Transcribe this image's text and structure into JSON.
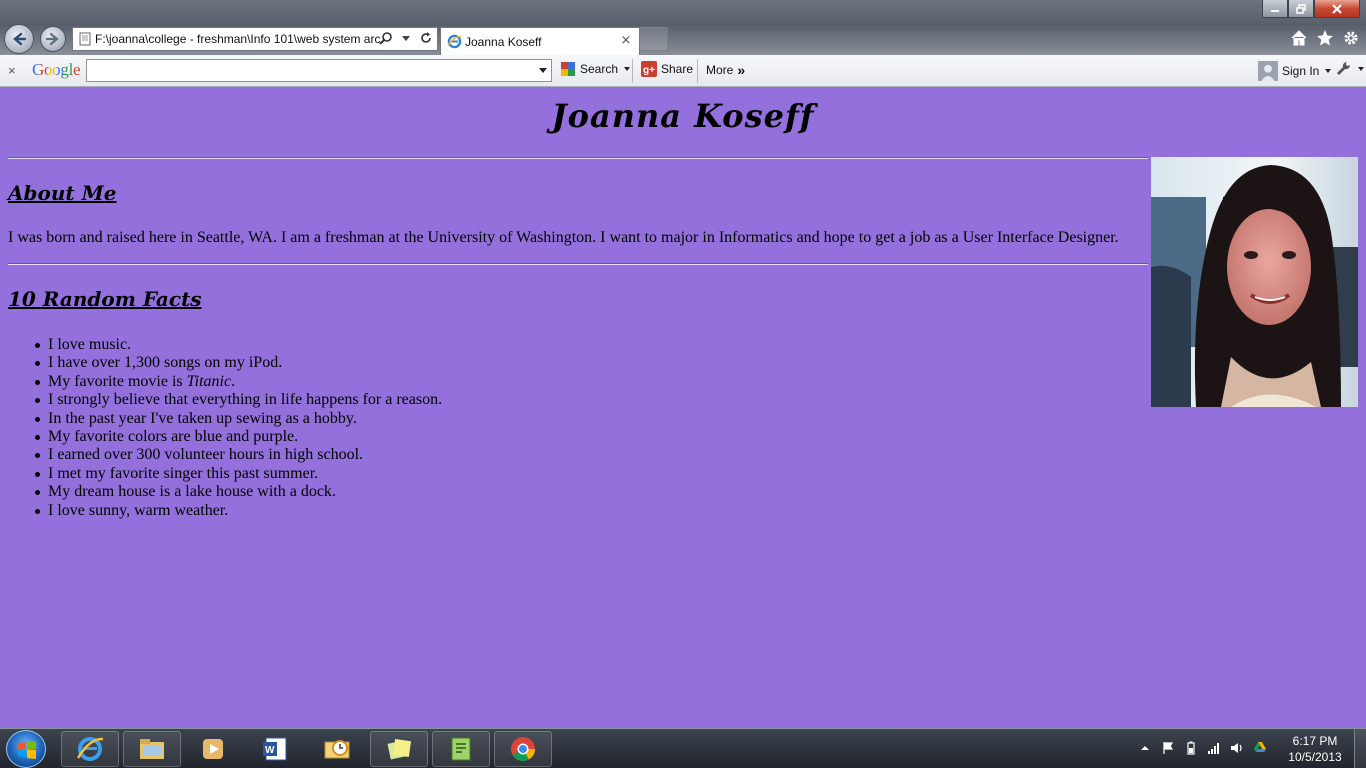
{
  "browser": {
    "address": "F:\\joanna\\college - freshman\\Info 101\\web system arc",
    "tab_title": "Joanna Koseff",
    "tab_close": "×"
  },
  "google_toolbar": {
    "close": "×",
    "logo": "Google",
    "search_label": "Search",
    "share_label": "Share",
    "more_label": "More",
    "more_chevrons": "»",
    "signin_label": "Sign In"
  },
  "page": {
    "title": "Joanna Koseff",
    "about_heading": "About Me",
    "about_text": "I was born and raised here in Seattle, WA. I am a freshman at the University of Washington. I want to major in Informatics and hope to get a job as a User Interface Designer.",
    "facts_heading": "10 Random Facts",
    "facts": [
      "I love music.",
      "I have over 1,300 songs on my iPod.",
      "My favorite movie is ",
      "I strongly believe that everything in life happens for a reason.",
      "In the past year I've taken up sewing as a hobby.",
      "My favorite colors are blue and purple.",
      "I earned over 300 volunteer hours in high school.",
      "I met my favorite singer this past summer.",
      "My dream house is a lake house with a dock.",
      "I love sunny, warm weather."
    ],
    "fact3_movie": "Titanic",
    "fact3_end": ".",
    "background_color": "#9370DB"
  },
  "taskbar": {
    "time": "6:17 PM",
    "date": "10/5/2013"
  },
  "icons": [
    "back-icon",
    "forward-icon",
    "search-icon",
    "refresh-icon",
    "home-icon",
    "favorites-star-icon",
    "settings-gear-icon"
  ]
}
